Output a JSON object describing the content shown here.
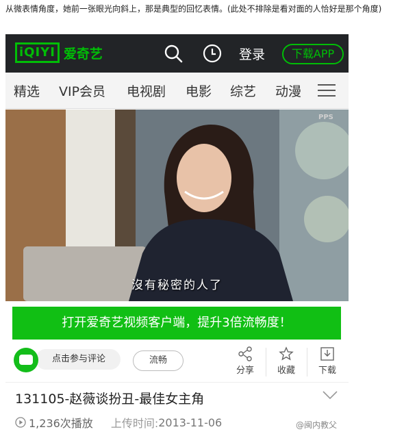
{
  "caption": "从微表情角度，她前一张眼光向斜上，那是典型的回忆表情。(此处不排除是看对面的人恰好是那个角度)",
  "topbar": {
    "logo_mark": "iQIYI",
    "logo_text": "爱奇艺",
    "login_label": "登录",
    "download_label": "下载APP",
    "icons": [
      "search-icon",
      "clock-icon"
    ]
  },
  "nav": {
    "items": [
      "精选",
      "VIP会员",
      "电视剧",
      "电影",
      "综艺",
      "动漫"
    ],
    "menu_icon": "hamburger-icon"
  },
  "video": {
    "subtitle": "沒有秘密的人了",
    "watermark": "PPS"
  },
  "promo": {
    "label": "打开爱奇艺视频客户端，提升3倍流畅度！"
  },
  "actions": {
    "comment_label": "点击参与评论",
    "quality_label": "流畅",
    "share_label": "分享",
    "collect_label": "收藏",
    "download_label": "下载"
  },
  "video_info": {
    "title": "131105-赵薇谈扮丑-最佳女主角",
    "plays": "1,236次播放",
    "upload_label": "上传时间:",
    "upload_date": "2013-11-06"
  },
  "weibo_watermark": "@闽内教父",
  "colors": {
    "brand_green": "#00be06",
    "topbar_bg": "#222427",
    "promo_green": "#11bf14"
  }
}
